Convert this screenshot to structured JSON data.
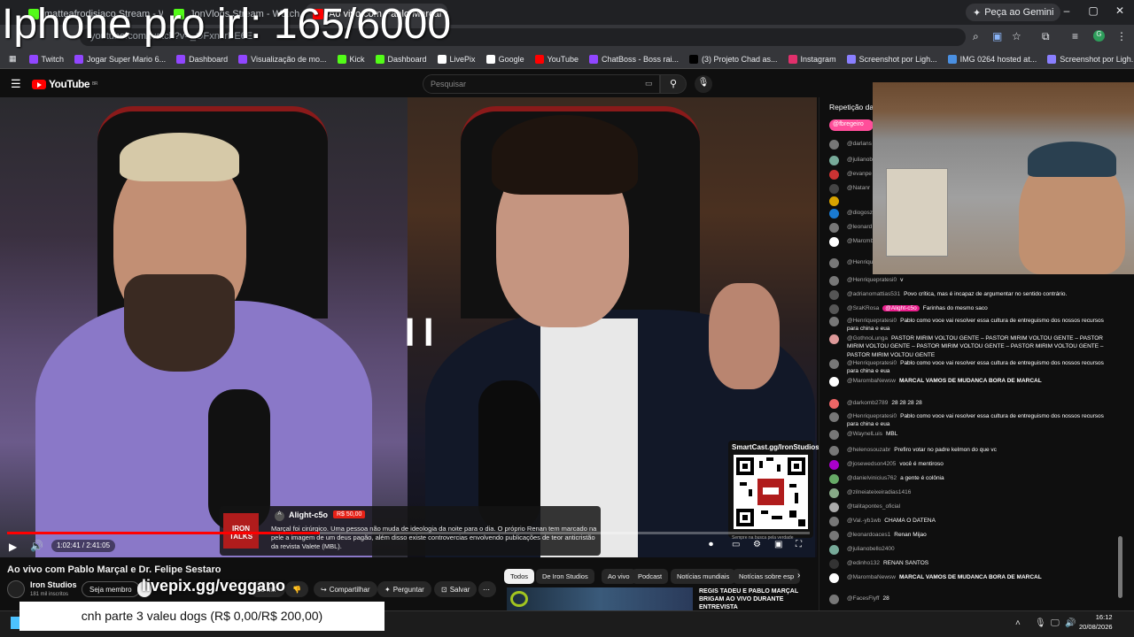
{
  "stream_overlay": {
    "title": "Iphone pro irl: 165/6000",
    "goal_text": "cnh parte 3 valeu dogs (R$ 0,00/R$ 200,00)",
    "banner_text": "livepix.gg/veggano"
  },
  "browser": {
    "tabs": [
      {
        "title": "matteafrodisiaco Stream - Wat"
      },
      {
        "title": "JonVlogs Stream - Watch Live o"
      },
      {
        "title": "Ao vivo com Pablo Marçal e Dr."
      }
    ],
    "gemini_label": "Peça ao Gemini",
    "url": "youtube.com/watch?v=_OFxnxrBE6E",
    "bookmarks": [
      {
        "label": "Twitch",
        "color": "#9146ff"
      },
      {
        "label": "Jogar Super Mario 6...",
        "color": "#9146ff"
      },
      {
        "label": "Dashboard",
        "color": "#9146ff"
      },
      {
        "label": "Visualização de mo...",
        "color": "#9146ff"
      },
      {
        "label": "Kick",
        "color": "#53fc18"
      },
      {
        "label": "Dashboard",
        "color": "#53fc18"
      },
      {
        "label": "LivePix",
        "color": "#ffffff"
      },
      {
        "label": "Google",
        "color": "#ffffff"
      },
      {
        "label": "YouTube",
        "color": "#ff0000"
      },
      {
        "label": "ChatBoss - Boss rai...",
        "color": "#9146ff"
      },
      {
        "label": "(3) Projeto Chad as...",
        "color": "#000000"
      },
      {
        "label": "Instagram",
        "color": "#e1306c"
      },
      {
        "label": "Screenshot por Ligh...",
        "color": "#8a7fff"
      },
      {
        "label": "IMG 0264 hosted at...",
        "color": "#4a90e2"
      },
      {
        "label": "Screenshot por Ligh...",
        "color": "#8a7fff"
      }
    ]
  },
  "youtube": {
    "logo_text": "YouTube",
    "country": "BR",
    "search_placeholder": "Pesquisar",
    "video_title": "Ao vivo com Pablo Marçal e Dr. Felipe Sestaro",
    "channel": {
      "name": "Iron Studios",
      "subs": "181 mil inscritos"
    },
    "buttons": {
      "join": "Seja membro",
      "like_count": "15 mil",
      "share": "Compartilhar",
      "ask": "Perguntar",
      "save": "Salvar"
    },
    "player": {
      "time": "1:02:41 / 2:41:05",
      "progress": 0.39
    },
    "superchat": {
      "logo": "IRON TALKS",
      "name": "Alight-c5o",
      "amount": "R$ 50,00",
      "text": "Marçal foi cirúrgico. Uma pessoa não muda de ideologia da noite para o dia. O próprio Renan tem marcado na pele a imagem de um deus pagão, além disso existe controvercias envolvendo publicações de teor anticristão da revista Valete (MBL)."
    },
    "qr": {
      "label": "SmartCast.gg/IronStudios",
      "sub": "Sempre na busca pela verdade"
    },
    "chips": [
      "Todos",
      "De Iron Studios",
      "Ao vivo",
      "Podcast",
      "Notícias mundiais",
      "Notícias sobre esp"
    ],
    "related_title": "REGIS TADEU E PABLO MARÇAL BRIGAM AO VIVO DURANTE ENTREVISTA"
  },
  "chat": {
    "header": "Repetição das",
    "pinned": "@fbregeiro",
    "messages": [
      {
        "user": "@darlans",
        "text": "",
        "color": "#777"
      },
      {
        "user": "@julianob",
        "text": "",
        "color": "#7a9"
      },
      {
        "user": "@evanpe",
        "text": "",
        "color": "#c33"
      },
      {
        "user": "@Natanr",
        "text": "",
        "color": "#444"
      },
      {
        "user": "",
        "text": "",
        "color": "#d9a400"
      },
      {
        "user": "@diogosz",
        "text": "",
        "color": "#1a7ad0"
      },
      {
        "user": "@leonard",
        "text": "",
        "color": "#777"
      },
      {
        "user": "@Marcmb",
        "text": "MARCAL",
        "color": "#fff"
      },
      {
        "user": "@Henrique",
        "text": "para china",
        "color": "#777"
      },
      {
        "user": "@Henriquepratesi0",
        "text": "v",
        "color": "#777"
      },
      {
        "user": "@adrianomattias531",
        "text": "Povo crítica, mas é incapaz de argumentar no sentido contrário.",
        "color": "#555"
      },
      {
        "user": "@SraKRosa",
        "text": "Farinhas do mesmo saco",
        "tag": "@Alight-c5o",
        "color": "#555"
      },
      {
        "user": "@Henriquepratesi0",
        "text": "Pablo como voce vai resolver essa cultura de entreguismo dos nossos recursos para china e eua",
        "color": "#777"
      },
      {
        "user": "@GothnoLunga",
        "text": "PASTOR MIRIM VOLTOU GENTE – PASTOR MIRIM VOLTOU GENTE – PASTOR MIRIM VOLTOU GENTE – PASTOR MIRIM VOLTOU GENTE – PASTOR MIRIM VOLTOU GENTE – PASTOR MIRIM VOLTOU GENTE",
        "color": "#d99"
      },
      {
        "user": "@Henriquepratesi0",
        "text": "Pablo como voce vai resolver essa cultura de entreguismo dos nossos recursos para china e eua",
        "color": "#777"
      },
      {
        "user": "@MarombaNewsw",
        "text": "MARCAL VAMOS DE MUDANCA BORA DE MARCAL",
        "color": "#fff"
      },
      {
        "user": "@darkomb2789",
        "text": "28 28 28 28",
        "color": "#e66"
      },
      {
        "user": "@Henriquepratesi0",
        "text": "Pablo como voce vai resolver essa cultura de entreguismo dos nossos recursos para china e eua",
        "color": "#777"
      },
      {
        "user": "@WaynelLuis",
        "text": "MBL",
        "color": "#777"
      },
      {
        "user": "@helenosouzabr",
        "text": "Prefiro votar no padre kelmon do que vc",
        "color": "#777"
      },
      {
        "user": "@josewedson4205",
        "text": "você é mentiroso",
        "color": "#a0c"
      },
      {
        "user": "@danielvinicius762",
        "text": "a gente é colônia",
        "color": "#6a6"
      },
      {
        "user": "@zilneiateixeiradias1416",
        "text": "",
        "color": "#8a8"
      },
      {
        "user": "@talitapontes_oficial",
        "text": "",
        "color": "#aaa"
      },
      {
        "user": "@Val.-yb1wb",
        "text": "CHAMA O DATENA",
        "color": "#777"
      },
      {
        "user": "@leonardoaces1",
        "text": "Renan Mijao",
        "color": "#777"
      },
      {
        "user": "@julianobello2400",
        "text": "",
        "color": "#7a9"
      },
      {
        "user": "@edinho132",
        "text": "RENAN SANTOS",
        "color": "#333"
      },
      {
        "user": "@MarombaNewsw",
        "text": "MARCAL VAMOS DE MUDANCA BORA DE MARCAL",
        "color": "#fff"
      },
      {
        "user": "@FacesFlyff",
        "text": "28",
        "color": "#777"
      }
    ]
  },
  "taskbar": {
    "time": "16:12",
    "date": "20/08/2026"
  }
}
